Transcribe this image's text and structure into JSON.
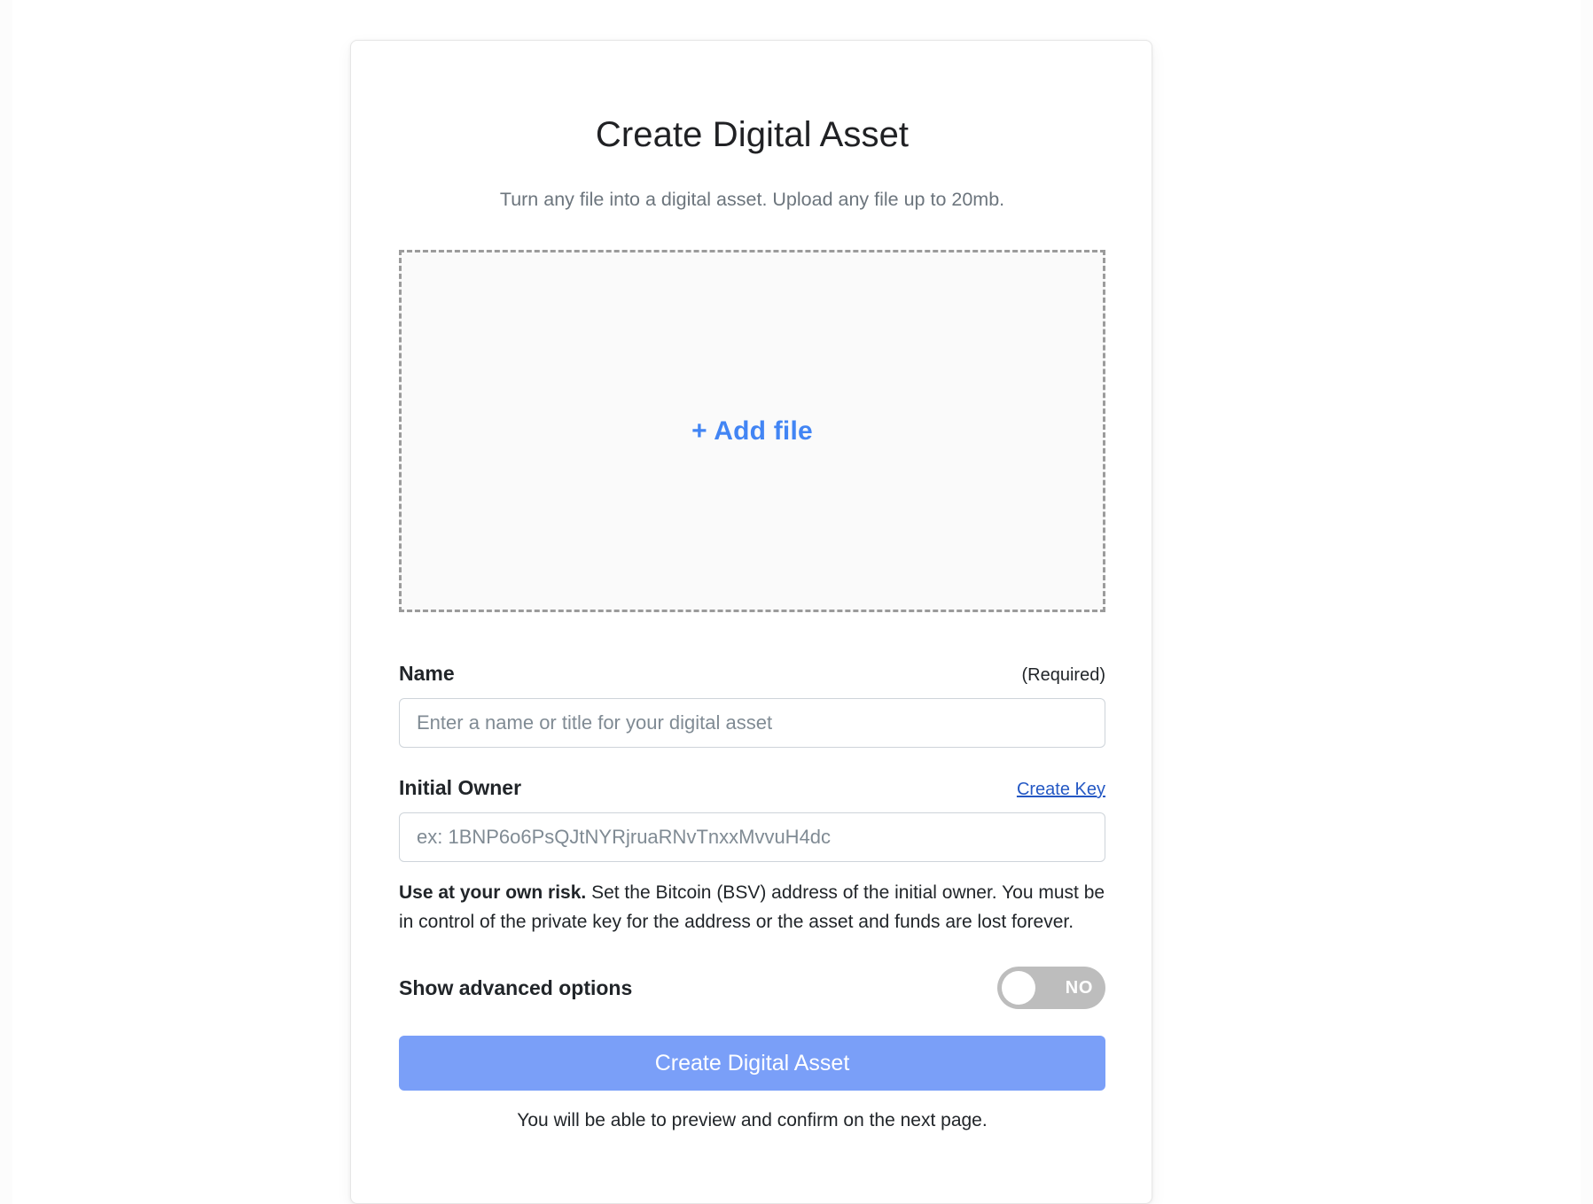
{
  "card": {
    "title": "Create Digital Asset",
    "subtitle": "Turn any file into a digital asset. Upload any file up to 20mb."
  },
  "dropzone": {
    "label": "+ Add file",
    "accent_color": "#4285f4",
    "border_color": "#9b9b9b",
    "background_color": "#fafafa"
  },
  "name_field": {
    "label": "Name",
    "requirement": "(Required)",
    "placeholder": "Enter a name or title for your digital asset",
    "value": ""
  },
  "owner_field": {
    "label": "Initial Owner",
    "link_label": "Create Key",
    "link_color": "#2458c4",
    "placeholder": "ex: 1BNP6o6PsQJtNYRjruaRNvTnxxMvvuH4dc",
    "value": "",
    "warning_bold": "Use at your own risk.",
    "warning_rest": " Set the Bitcoin (BSV) address of the initial owner. You must be in control of the private key for the address or the asset and funds are lost forever."
  },
  "advanced_toggle": {
    "label": "Show advanced options",
    "state": "NO",
    "enabled": false,
    "track_color": "#bdbdbd"
  },
  "submit": {
    "label": "Create Digital Asset",
    "color": "#7a9ff8",
    "footnote": "You will be able to preview and confirm on the next page."
  }
}
